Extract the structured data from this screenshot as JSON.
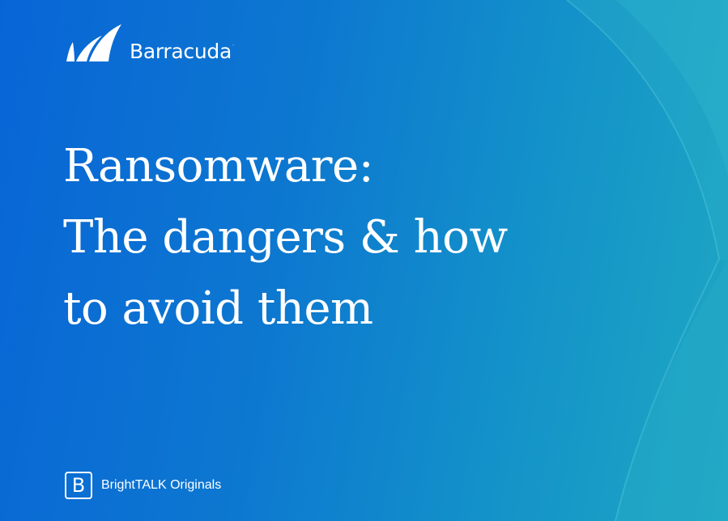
{
  "brand": {
    "name": "Barracuda",
    "trademark": ".",
    "logo_icon": "barracuda-fin-logo"
  },
  "title_lines": [
    "Ransomware:",
    "The dangers & how",
    "to avoid them"
  ],
  "footer": {
    "icon_letter": "B",
    "icon": "brighttalk-logo",
    "label": "BrightTALK Originals"
  },
  "colors": {
    "background_start": "#0865d6",
    "background_end": "#1fa7c3",
    "text": "#ffffff"
  }
}
